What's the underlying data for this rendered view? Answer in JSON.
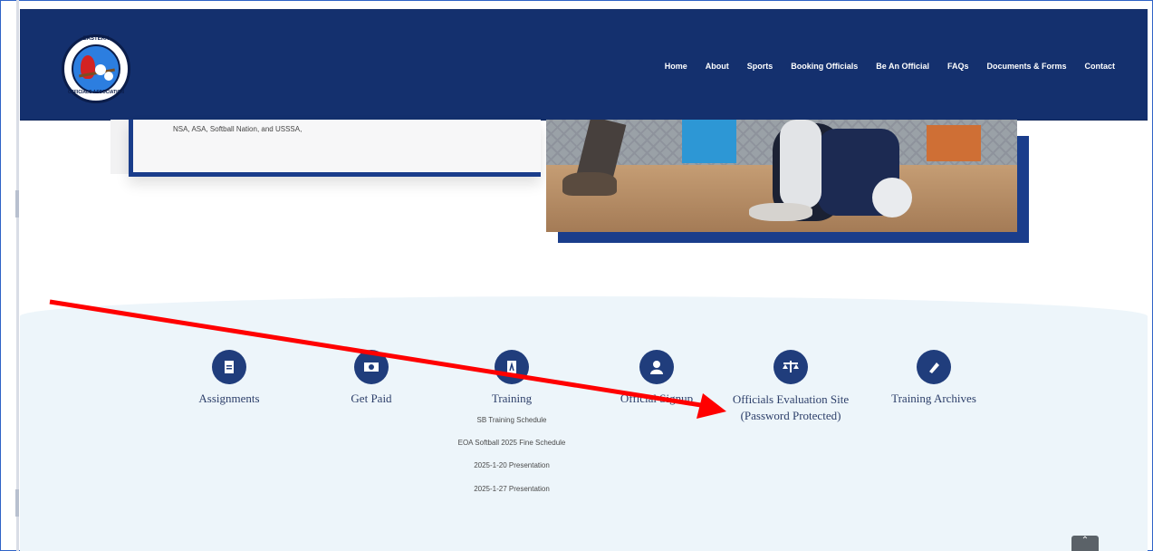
{
  "header": {
    "logo_text_top": "EASTERN",
    "logo_text_bottom": "OFFICIALS ASSOCIATION",
    "nav": [
      "Home",
      "About",
      "Sports",
      "Booking Officials",
      "Be An Official",
      "FAQs",
      "Documents & Forms",
      "Contact"
    ]
  },
  "intro_text": "NSA, ASA, Softball Nation, and USSSA,",
  "links": [
    {
      "label": "Assignments",
      "icon": "document-icon"
    },
    {
      "label": "Get Paid",
      "icon": "money-icon"
    },
    {
      "label": "Training",
      "icon": "pdf-icon",
      "sub": [
        "SB Training Schedule",
        "EOA Softball 2025 Fine Schedule",
        "2025-1-20 Presentation",
        "2025-1-27 Presentation"
      ]
    },
    {
      "label": "Official Signup",
      "icon": "user-icon"
    },
    {
      "label": "Officials Evaluation Site (Password Protected)",
      "icon": "scale-icon"
    },
    {
      "label": "Training Archives",
      "icon": "pen-icon"
    }
  ],
  "scroll_top_icon": "chevron-up-icon"
}
